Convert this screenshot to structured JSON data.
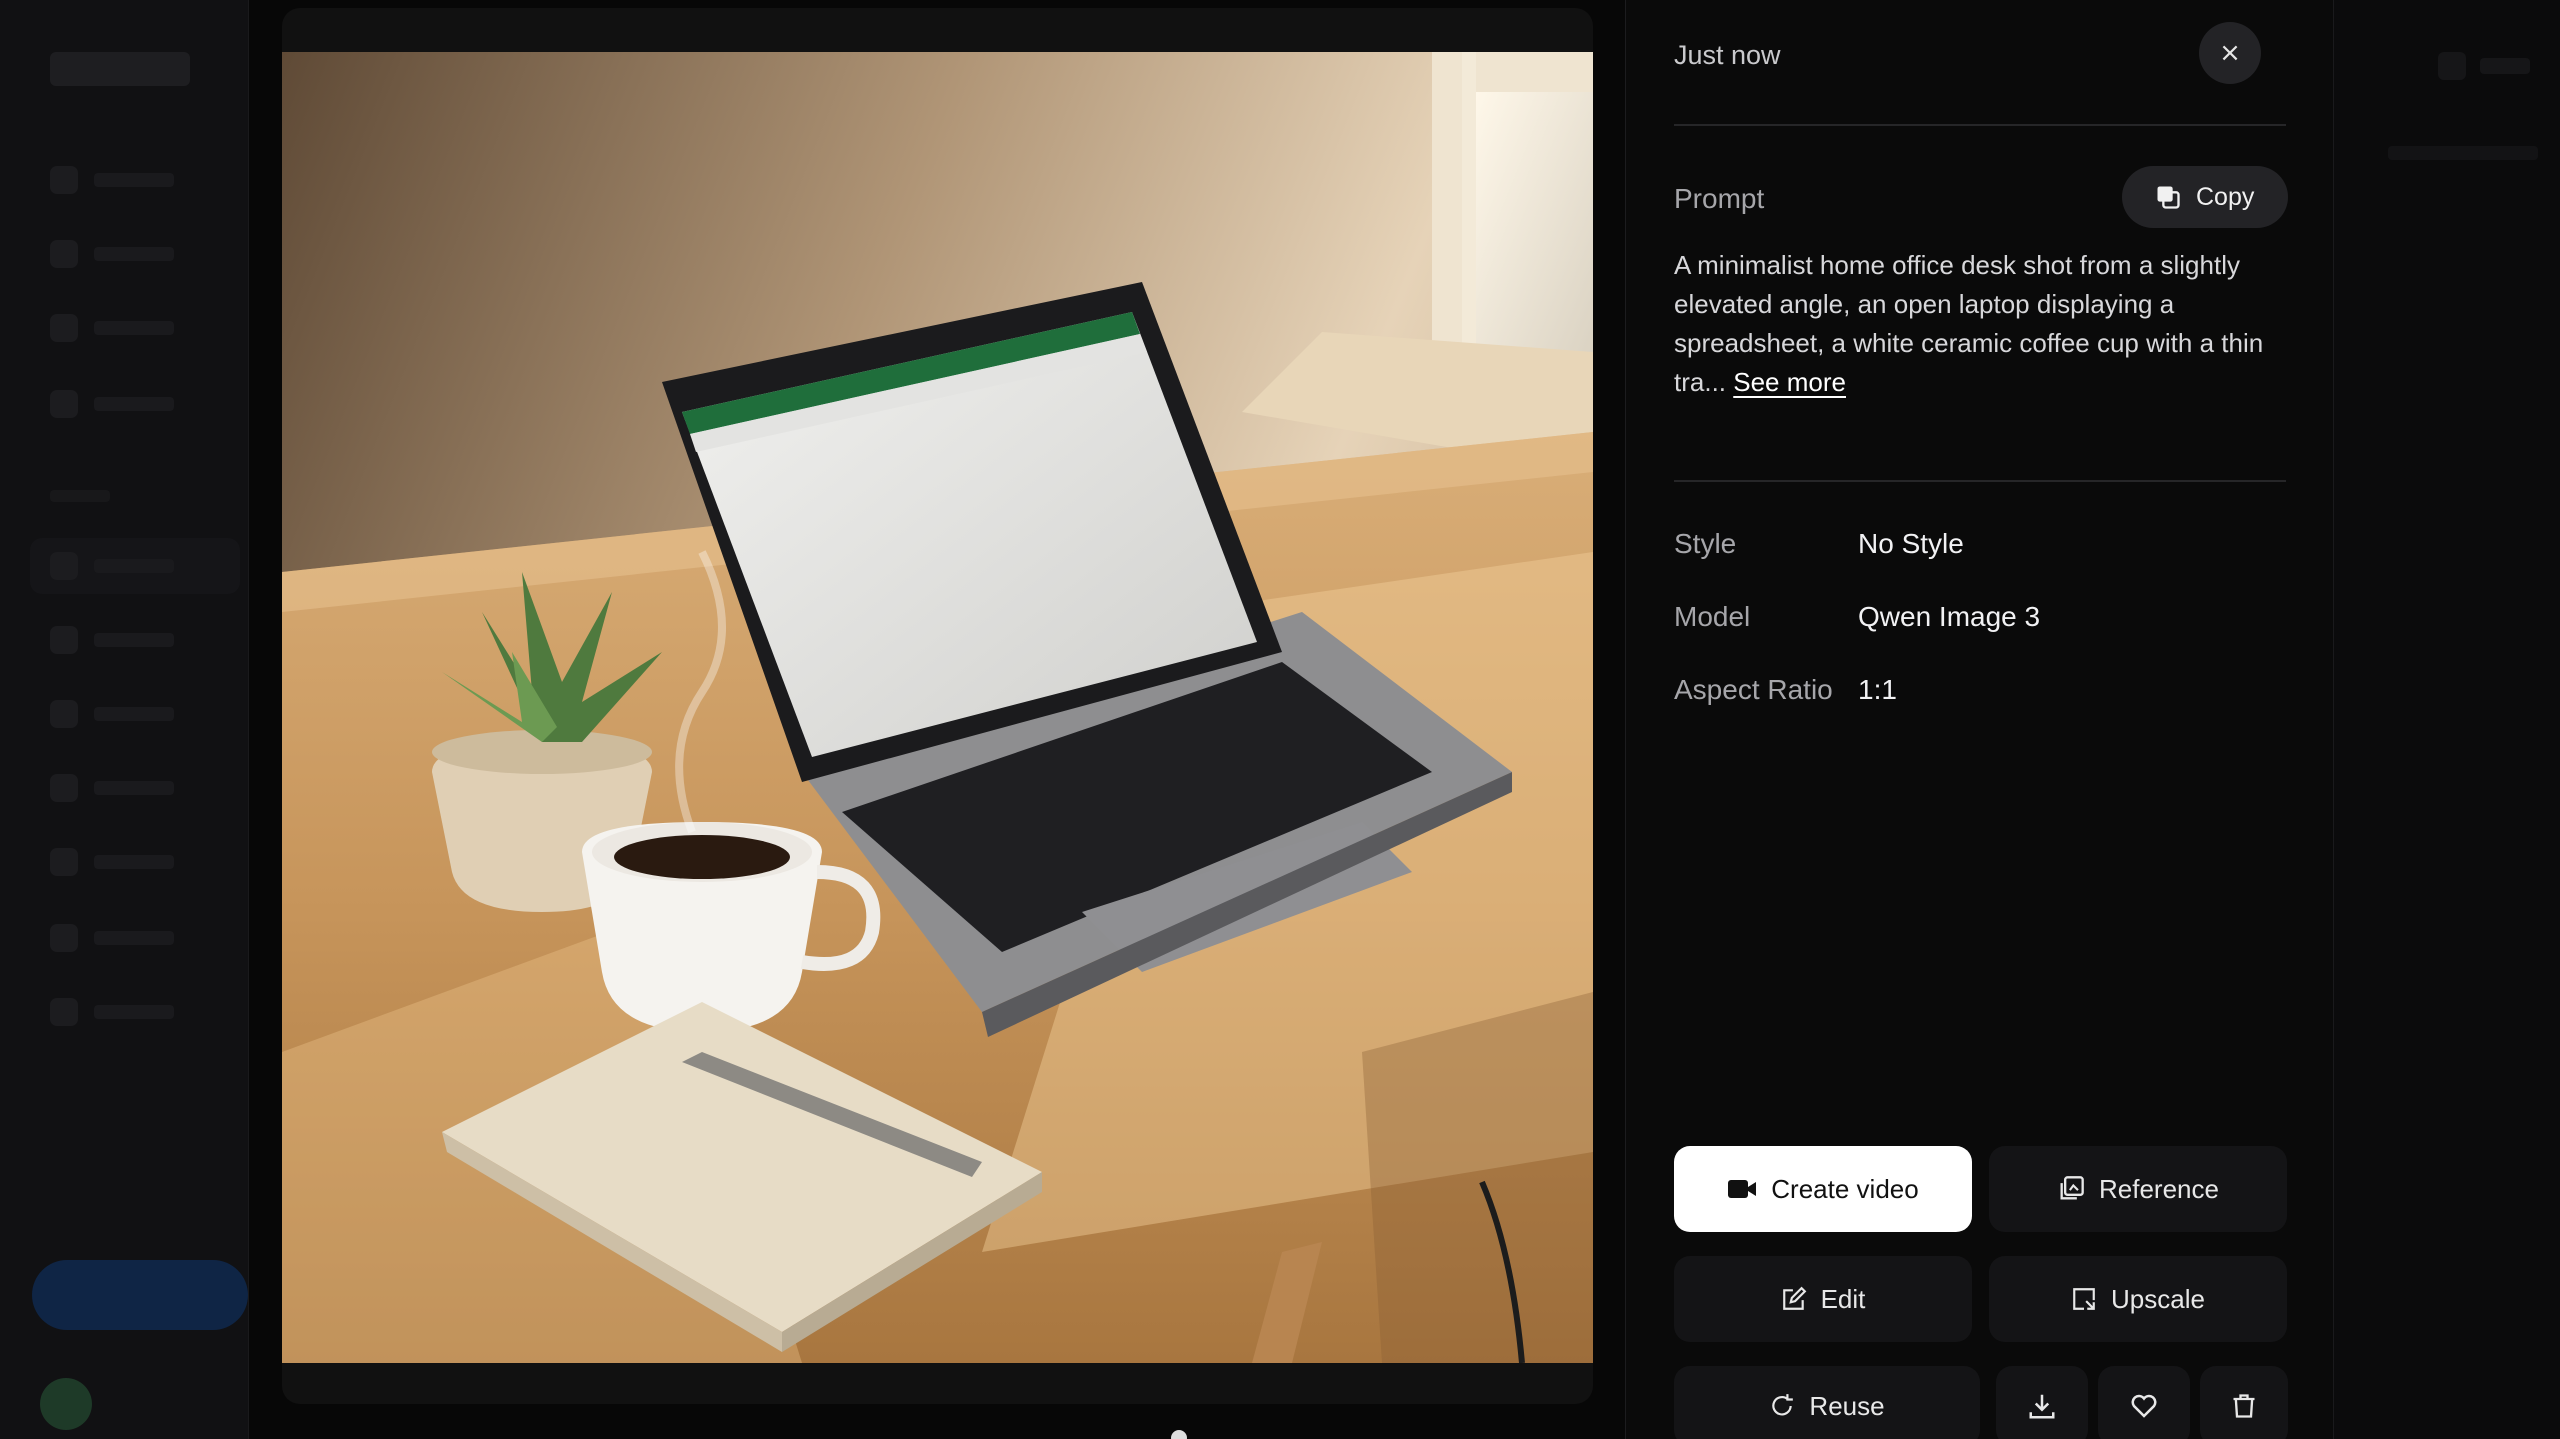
{
  "detail": {
    "timestamp": "Just now",
    "close_symbol": "×",
    "prompt_label": "Prompt",
    "copy_label": "Copy",
    "prompt_text": "A minimalist home office desk shot from a slightly elevated angle, an open laptop displaying a spreadsheet, a white ceramic coffee cup with a thin tra...",
    "see_more_label": "See more",
    "meta": [
      {
        "label": "Style",
        "value": "No Style"
      },
      {
        "label": "Model",
        "value": "Qwen Image 3"
      },
      {
        "label": "Aspect Ratio",
        "value": "1:1"
      }
    ]
  },
  "actions": {
    "create_video": "Create video",
    "reference": "Reference",
    "edit": "Edit",
    "upscale": "Upscale",
    "reuse": "Reuse"
  },
  "icons": [
    "close-icon",
    "copy-icon",
    "video-camera-icon",
    "reference-icon",
    "edit-icon",
    "upscale-icon",
    "reuse-icon",
    "download-icon",
    "heart-icon",
    "trash-icon"
  ],
  "colors": {
    "panel_bg": "#0a0a0a",
    "button_bg": "#141416",
    "primary_button_bg": "#ffffff",
    "muted_text": "#a6a6aa"
  }
}
